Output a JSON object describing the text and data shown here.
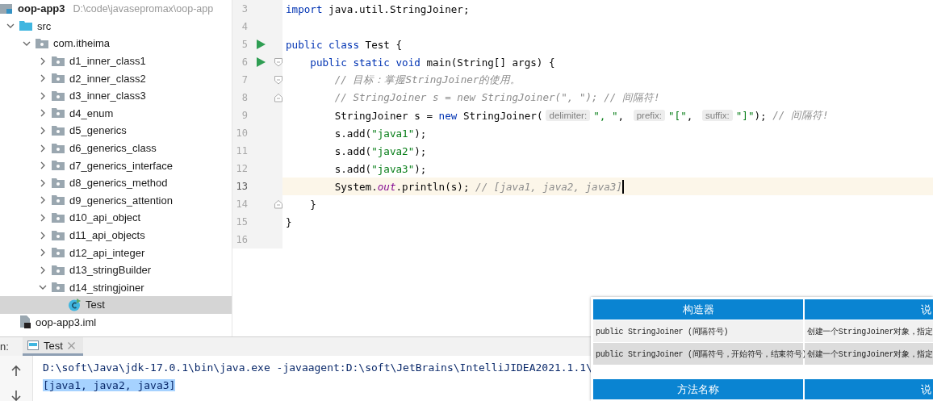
{
  "project_tree": {
    "items": [
      {
        "label": "oop-app3",
        "kind": "module",
        "path": "D:\\code\\javasepromax\\oop-app",
        "selected": false,
        "children": [
          {
            "label": "src",
            "kind": "source_folder",
            "expanded": true,
            "selected": false,
            "children": [
              {
                "label": "com.itheima",
                "kind": "package",
                "expanded": true,
                "selected": false,
                "children": [
                  {
                    "label": "d1_inner_class1",
                    "kind": "package",
                    "expanded": false,
                    "selected": false
                  },
                  {
                    "label": "d2_inner_class2",
                    "kind": "package",
                    "expanded": false,
                    "selected": false
                  },
                  {
                    "label": "d3_inner_class3",
                    "kind": "package",
                    "expanded": false,
                    "selected": false
                  },
                  {
                    "label": "d4_enum",
                    "kind": "package",
                    "expanded": false,
                    "selected": false
                  },
                  {
                    "label": "d5_generics",
                    "kind": "package",
                    "expanded": false,
                    "selected": false
                  },
                  {
                    "label": "d6_generics_class",
                    "kind": "package",
                    "expanded": false,
                    "selected": false
                  },
                  {
                    "label": "d7_generics_interface",
                    "kind": "package",
                    "expanded": false,
                    "selected": false
                  },
                  {
                    "label": "d8_generics_method",
                    "kind": "package",
                    "expanded": false,
                    "selected": false
                  },
                  {
                    "label": "d9_generics_attention",
                    "kind": "package",
                    "expanded": false,
                    "selected": false
                  },
                  {
                    "label": "d10_api_object",
                    "kind": "package",
                    "expanded": false,
                    "selected": false
                  },
                  {
                    "label": "d11_api_objects",
                    "kind": "package",
                    "expanded": false,
                    "selected": false
                  },
                  {
                    "label": "d12_api_integer",
                    "kind": "package",
                    "expanded": false,
                    "selected": false
                  },
                  {
                    "label": "d13_stringBuilder",
                    "kind": "package",
                    "expanded": false,
                    "selected": false
                  },
                  {
                    "label": "d14_stringjoiner",
                    "kind": "package",
                    "expanded": true,
                    "selected": false,
                    "children": [
                      {
                        "label": "Test",
                        "kind": "class",
                        "selected": true
                      }
                    ]
                  }
                ]
              }
            ]
          },
          {
            "label": "oop-app3.iml",
            "kind": "file",
            "selected": false
          }
        ]
      }
    ]
  },
  "editor": {
    "lines": [
      {
        "number": "3",
        "run": false,
        "fold_start": false,
        "fold_end": false,
        "current": false,
        "tokens": [
          {
            "kind": "kw",
            "text": "import "
          },
          {
            "kind": "plain",
            "text": "java.util.StringJoiner;"
          }
        ]
      },
      {
        "number": "4",
        "run": false,
        "fold_start": false,
        "fold_end": false,
        "current": false
      },
      {
        "number": "5",
        "run": true,
        "fold_start": false,
        "fold_end": false,
        "current": false,
        "tokens": [
          {
            "kind": "kw",
            "text": "public class "
          },
          {
            "kind": "plain",
            "text": "Test {"
          }
        ]
      },
      {
        "number": "6",
        "run": true,
        "fold_start": true,
        "fold_end": false,
        "current": false,
        "tokens": [
          {
            "kind": "kw",
            "text": "    public static void "
          },
          {
            "kind": "plain",
            "text": "main(String[] args) {"
          }
        ]
      },
      {
        "number": "7",
        "run": false,
        "fold_start": true,
        "fold_end": false,
        "current": false,
        "tokens": [
          {
            "kind": "cmt",
            "text": "        // 目标：掌握StringJoiner的使用。"
          }
        ]
      },
      {
        "number": "8",
        "run": false,
        "fold_start": false,
        "fold_end": true,
        "current": false,
        "tokens": [
          {
            "kind": "cmt",
            "text": "        // StringJoiner s = new StringJoiner(\", \"); // 间隔符!"
          }
        ]
      },
      {
        "number": "9",
        "run": false,
        "fold_start": false,
        "fold_end": false,
        "current": false,
        "tokens": [
          {
            "kind": "plain",
            "text": "        StringJoiner s = "
          },
          {
            "kind": "kw",
            "text": "new "
          },
          {
            "kind": "plain",
            "text": "StringJoiner("
          },
          {
            "kind": "hint",
            "text": "delimiter:"
          },
          {
            "kind": "str",
            "text": "\", \""
          },
          {
            "kind": "plain",
            "text": ", "
          },
          {
            "kind": "hint",
            "text": "prefix:"
          },
          {
            "kind": "str",
            "text": "\"[\""
          },
          {
            "kind": "plain",
            "text": ", "
          },
          {
            "kind": "hint",
            "text": "suffix:"
          },
          {
            "kind": "str",
            "text": "\"]\""
          },
          {
            "kind": "plain",
            "text": "); "
          },
          {
            "kind": "cmt",
            "text": "// 间隔符!"
          }
        ]
      },
      {
        "number": "10",
        "run": false,
        "fold_start": false,
        "fold_end": false,
        "current": false,
        "tokens": [
          {
            "kind": "plain",
            "text": "        s.add("
          },
          {
            "kind": "str",
            "text": "\"java1\""
          },
          {
            "kind": "plain",
            "text": ");"
          }
        ]
      },
      {
        "number": "11",
        "run": false,
        "fold_start": false,
        "fold_end": false,
        "current": false,
        "tokens": [
          {
            "kind": "plain",
            "text": "        s.add("
          },
          {
            "kind": "str",
            "text": "\"java2\""
          },
          {
            "kind": "plain",
            "text": ");"
          }
        ]
      },
      {
        "number": "12",
        "run": false,
        "fold_start": false,
        "fold_end": false,
        "current": false,
        "tokens": [
          {
            "kind": "plain",
            "text": "        s.add("
          },
          {
            "kind": "str",
            "text": "\"java3\""
          },
          {
            "kind": "plain",
            "text": ");"
          }
        ]
      },
      {
        "number": "13",
        "run": false,
        "fold_start": false,
        "fold_end": false,
        "current": true,
        "tokens": [
          {
            "kind": "plain",
            "text": "        System."
          },
          {
            "kind": "field",
            "text": "out"
          },
          {
            "kind": "plain",
            "text": ".println(s); "
          },
          {
            "kind": "cmt",
            "text": "// [java1, java2, java3]"
          }
        ]
      },
      {
        "number": "14",
        "run": false,
        "fold_start": false,
        "fold_end": true,
        "current": false,
        "tokens": [
          {
            "kind": "plain",
            "text": "    }"
          }
        ]
      },
      {
        "number": "15",
        "run": false,
        "fold_start": false,
        "fold_end": false,
        "current": false,
        "tokens": [
          {
            "kind": "plain",
            "text": "}"
          }
        ]
      },
      {
        "number": "16",
        "run": false,
        "fold_start": false,
        "fold_end": false,
        "current": false
      }
    ]
  },
  "run_panel": {
    "label": "n:",
    "tabs": [
      {
        "label": "Test",
        "selected": true
      }
    ],
    "console": [
      {
        "text": "D:\\soft\\Java\\jdk-17.0.1\\bin\\java.exe -javaagent:D:\\soft\\JetBrains\\IntelliJIDEA2021.1.1\\",
        "selected": false
      },
      {
        "text": "[java1, java2, java3]",
        "selected": true
      }
    ]
  },
  "slide_overlay": {
    "tables": [
      {
        "columns": [
          "构造器",
          "说"
        ],
        "rows": [
          [
            "public StringJoiner (间隔符号)",
            "创建一个StringJoiner对象，指定"
          ],
          [
            "public StringJoiner (间隔符号，开始符号，结束符号)",
            "创建一个StringJoiner对象，指定"
          ]
        ]
      },
      {
        "columns": [
          "方法名称",
          "说"
        ]
      }
    ]
  }
}
